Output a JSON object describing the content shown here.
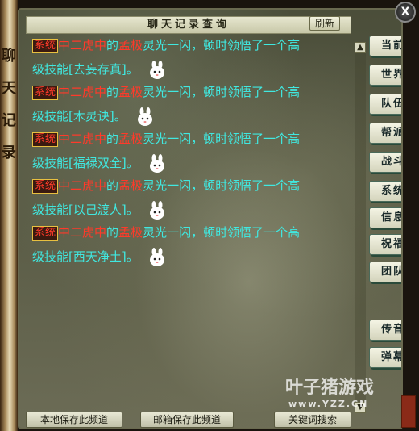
{
  "window": {
    "title": "聊天记录查询",
    "refresh_label": "刷新",
    "close_label": "X"
  },
  "scroll_text": [
    "聊",
    "天",
    "记",
    "录"
  ],
  "messages": [
    {
      "tag": "系统",
      "player": "中二虎中",
      "de": "的",
      "rank": "孟极",
      "text": "灵光一闪，顿时领悟了一个高",
      "prefix": "级技能",
      "skill": "[去妄存真]",
      "end": "。"
    },
    {
      "tag": "系统",
      "player": "中二虎中",
      "de": "的",
      "rank": "孟极",
      "text": "灵光一闪，顿时领悟了一个高",
      "prefix": "级技能",
      "skill": "[木灵诀]",
      "end": "。"
    },
    {
      "tag": "系统",
      "player": "中二虎中",
      "de": "的",
      "rank": "孟极",
      "text": "灵光一闪，顿时领悟了一个高",
      "prefix": "级技能",
      "skill": "[福禄双全]",
      "end": "。"
    },
    {
      "tag": "系统",
      "player": "中二虎中",
      "de": "的",
      "rank": "孟极",
      "text": "灵光一闪，顿时领悟了一个高",
      "prefix": "级技能",
      "skill": "[以己渡人]",
      "end": "。"
    },
    {
      "tag": "系统",
      "player": "中二虎中",
      "de": "的",
      "rank": "孟极",
      "text": "灵光一闪，顿时领悟了一个高",
      "prefix": "级技能",
      "skill": "[西天净土]",
      "end": "。"
    }
  ],
  "channels": [
    "当前",
    "世界",
    "队伍",
    "帮派",
    "战斗",
    "系统",
    "信息",
    "祝福",
    "团队",
    "传音",
    "弹幕"
  ],
  "bottom": {
    "save_local": "本地保存此频道",
    "save_mail": "邮箱保存此频道",
    "keyword_search": "关键词搜索"
  },
  "watermark": {
    "main": "叶子猪游戏",
    "sub": "www.YZZ.CN"
  },
  "colors": {
    "player_red": "#ff3a2a",
    "text_cyan": "#40e8e0",
    "tag_border": "#e8c040"
  }
}
